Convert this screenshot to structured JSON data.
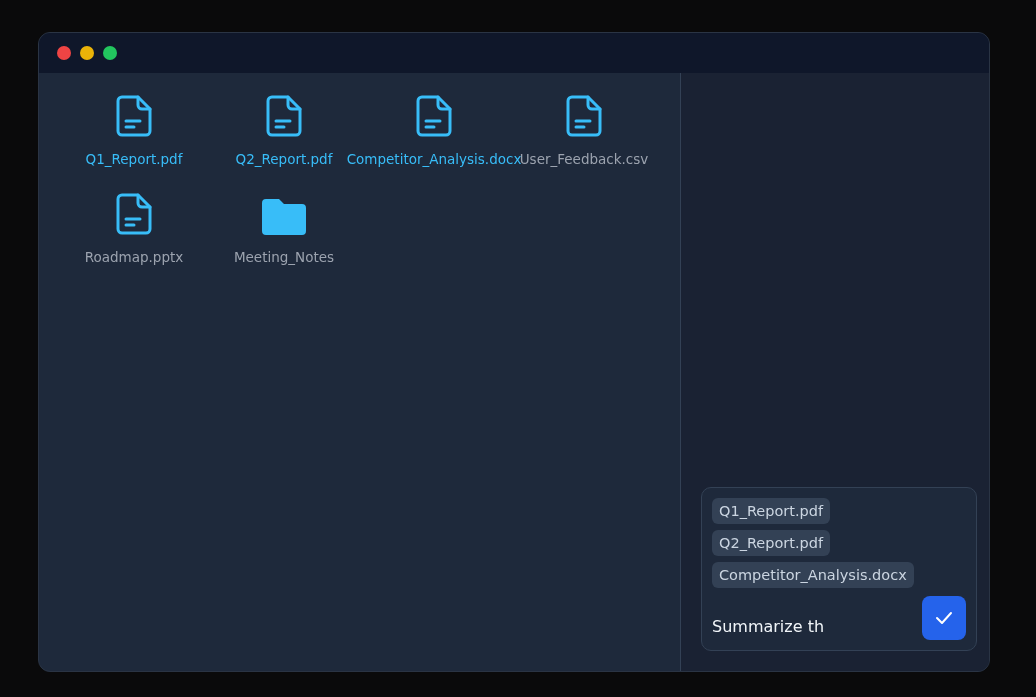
{
  "files": [
    {
      "name": "Q1_Report.pdf",
      "kind": "file",
      "selected": true
    },
    {
      "name": "Q2_Report.pdf",
      "kind": "file",
      "selected": true
    },
    {
      "name": "Competitor_Analysis.docx",
      "kind": "file",
      "selected": true
    },
    {
      "name": "User_Feedback.csv",
      "kind": "file",
      "selected": false
    },
    {
      "name": "Roadmap.pptx",
      "kind": "file",
      "selected": false
    },
    {
      "name": "Meeting_Notes",
      "kind": "folder",
      "selected": false
    }
  ],
  "composer": {
    "attachments": [
      "Q1_Report.pdf",
      "Q2_Report.pdf",
      "Competitor_Analysis.docx"
    ],
    "value": "Summarize th"
  }
}
